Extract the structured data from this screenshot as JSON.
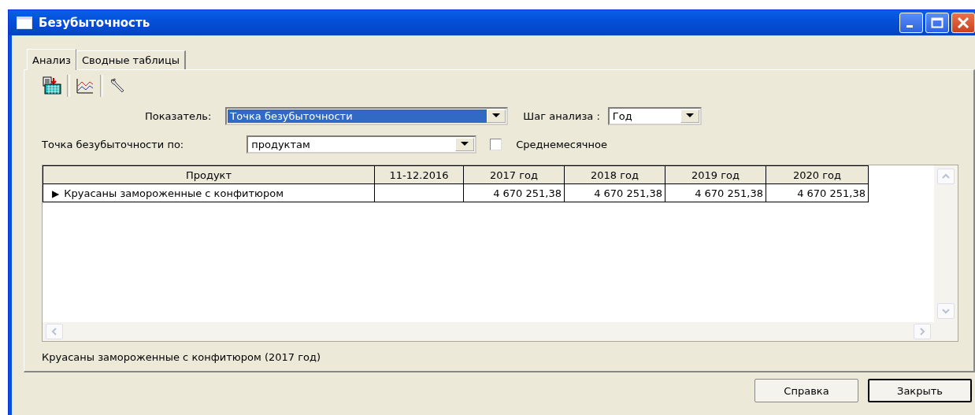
{
  "window": {
    "title": "Безубыточность"
  },
  "tabs": [
    {
      "label": "Анализ",
      "selected": true
    },
    {
      "label": "Сводные таблицы",
      "selected": false
    }
  ],
  "form": {
    "indicator": {
      "label": "Показатель:",
      "value": "Точка безубыточности",
      "highlighted": true
    },
    "step": {
      "label": "Шаг анализа :",
      "value": "Год",
      "highlighted": false
    },
    "breakdown": {
      "label": "Точка безубыточности по:",
      "value": "продуктам",
      "highlighted": false
    },
    "monthly": {
      "label": "Среднемесячное",
      "checked": false
    }
  },
  "table": {
    "columns": [
      "Продукт",
      "11-12.2016",
      "2017 год",
      "2018 год",
      "2019 год",
      "2020 год"
    ],
    "rows": [
      {
        "indicator": "▶",
        "cells": [
          "Круасаны замороженные с конфитюром",
          "",
          "4 670 251,38",
          "4 670 251,38",
          "4 670 251,38",
          "4 670 251,38"
        ]
      }
    ]
  },
  "status_text": "Круасаны замороженные с конфитюром (2017 год)",
  "buttons": [
    "Справка",
    "Закрыть"
  ]
}
